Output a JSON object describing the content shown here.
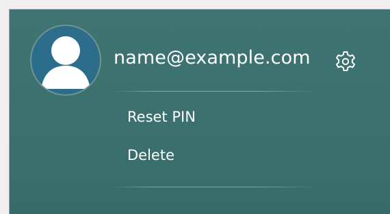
{
  "account": {
    "email": "name@example.com",
    "avatar_icon": "user-avatar-icon",
    "settings_icon": "gear-icon"
  },
  "menu": {
    "items": [
      {
        "label": "Reset PIN"
      },
      {
        "label": "Delete"
      }
    ]
  },
  "colors": {
    "panel_bg": "#3c7270",
    "avatar_bg": "#2c6d8c",
    "text": "#ffffff"
  }
}
